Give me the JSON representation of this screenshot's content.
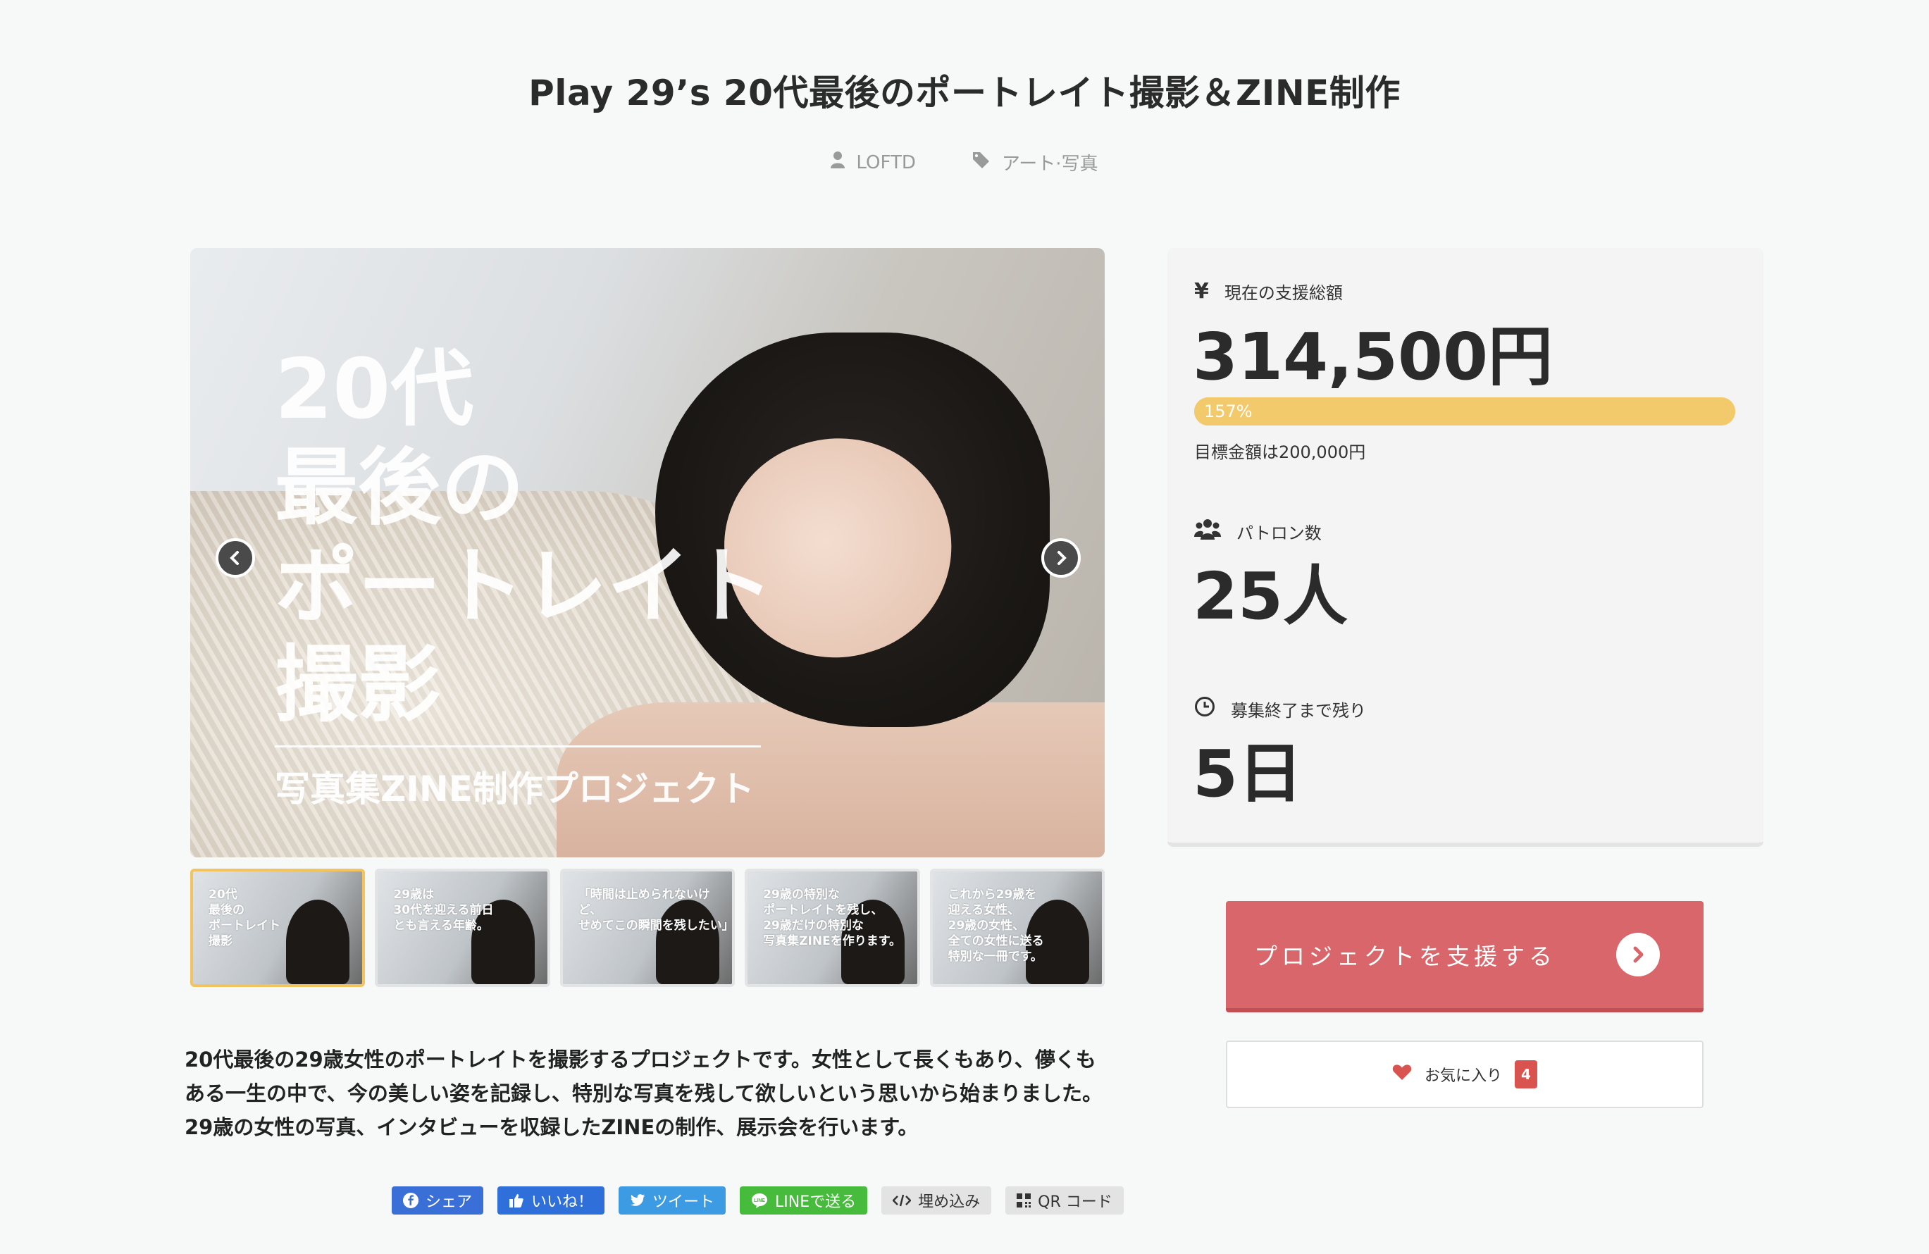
{
  "project": {
    "title": "Play 29’s 20代最後のポートレイト撮影＆ZINE制作",
    "author": "LOFTD",
    "category": "アート·写真"
  },
  "gallery": {
    "main_title": "20代\n最後の\nポートレイト\n撮影",
    "main_subtitle": "写真集ZINE制作プロジェクト",
    "thumbnails": [
      {
        "text": "20代\n最後の\nポートレイト\n撮影",
        "active": true
      },
      {
        "text": "29歳は\n30代を迎える前日\nとも言える年齢。",
        "active": false
      },
      {
        "text": "「時間は止められないけど、\nせめてこの瞬間を残したい」",
        "active": false
      },
      {
        "text": "29歳の特別な\nポートレイトを残し、\n29歳だけの特別な\n写真集ZINEを作ります。",
        "active": false
      },
      {
        "text": "これから29歳を\n迎える女性、\n29歳の女性、\n全ての女性に送る\n特別な一冊です。",
        "active": false
      }
    ]
  },
  "description": "20代最後の29歳女性のポートレイトを撮影するプロジェクトです。女性として長くもあり、儚くもある一生の中で、今の美しい姿を記録し、特別な写真を残して欲しいという思いから始まりました。29歳の女性の写真、インタビューを収録したZINEの制作、展示会を行います。",
  "share": {
    "facebook": "シェア",
    "like": "いいね！",
    "tweet": "ツイート",
    "line": "LINEで送る",
    "embed": "埋め込み",
    "qr": "QR コード"
  },
  "stats": {
    "total_label": "現在の支援総額",
    "total_value": "314,500円",
    "progress_text": "157%",
    "progress_percent": 157,
    "goal_text": "目標金額は200,000円",
    "patrons_label": "パトロン数",
    "patrons_value": "25人",
    "remaining_label": "募集終了まで残り",
    "remaining_value": "5日"
  },
  "actions": {
    "support_label": "プロジェクトを支援する",
    "favorite_label": "お気に入り",
    "favorite_count": "4"
  },
  "colors": {
    "accent_red": "#d8666a",
    "progress_yellow": "#f2c96b",
    "badge_red": "#d9534f"
  }
}
